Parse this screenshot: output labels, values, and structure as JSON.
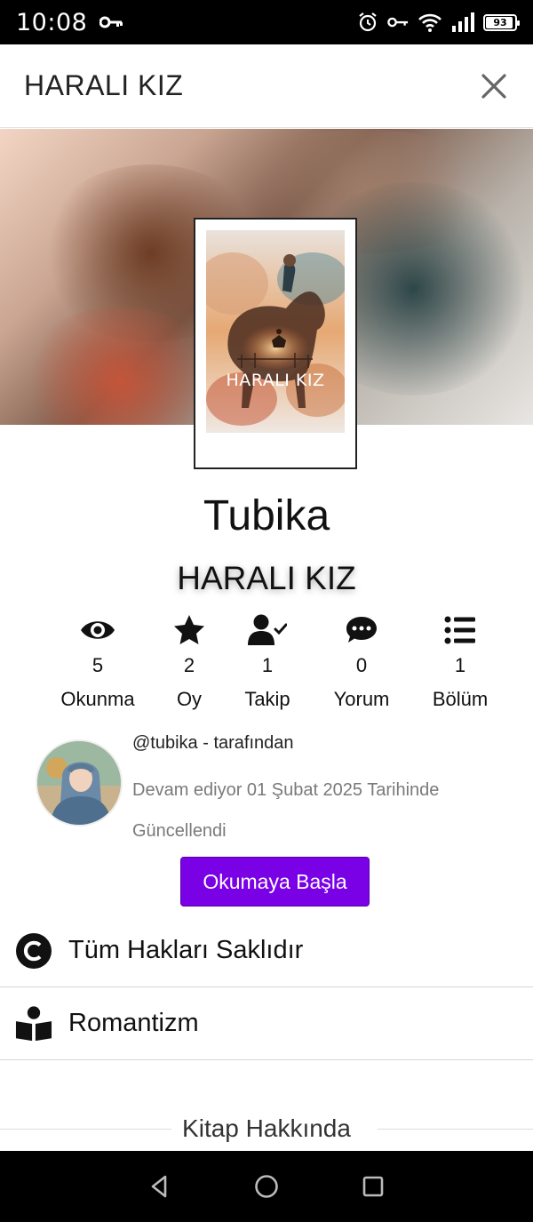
{
  "status_bar": {
    "time": "10:08",
    "battery": "93",
    "battery_level": 0.93
  },
  "header": {
    "title": "HARALI KIZ",
    "close_icon": "close-icon"
  },
  "cover": {
    "title_text": "HARALI KIZ"
  },
  "book": {
    "author": "Tubika",
    "title": "HARALI KIZ"
  },
  "stats": [
    {
      "icon": "eye-icon",
      "value": "5",
      "label": "Okunma"
    },
    {
      "icon": "star-icon",
      "value": "2",
      "label": "Oy"
    },
    {
      "icon": "user-check-icon",
      "value": "1",
      "label": "Takip"
    },
    {
      "icon": "comment-icon",
      "value": "0",
      "label": "Yorum"
    },
    {
      "icon": "list-icon",
      "value": "1",
      "label": "Bölüm"
    }
  ],
  "author_info": {
    "handle": "@tubika - tarafından",
    "status": "Devam ediyor 01 Şubat 2025 Tarihinde Güncellendi"
  },
  "start_button": {
    "label": "Okumaya Başla",
    "color": "#7a00e6"
  },
  "rows": [
    {
      "icon": "copyright-icon",
      "label": "Tüm Hakları Saklıdır"
    },
    {
      "icon": "book-reader-icon",
      "label": "Romantizm"
    }
  ],
  "about": {
    "label": "Kitap Hakkında"
  }
}
